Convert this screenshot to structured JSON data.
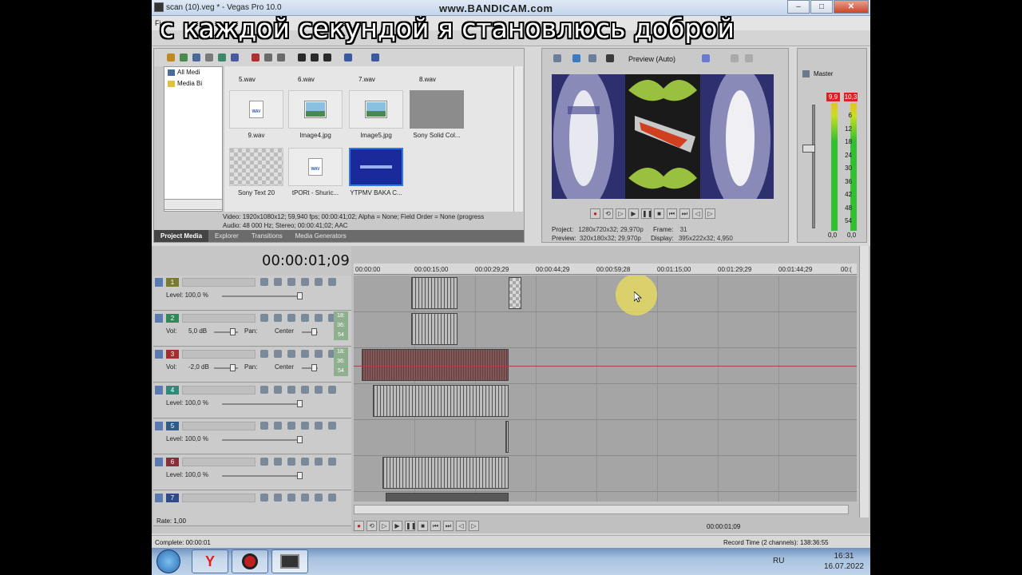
{
  "window": {
    "title": "scan (10).veg * - Vegas Pro 10.0",
    "minimize": "–",
    "maximize": "□",
    "close": "✕"
  },
  "watermark": "www.BANDICAM.com",
  "caption": "с каждой секундой я становлюсь доброй",
  "menu": {
    "first": "Fi"
  },
  "project_media": {
    "tree": [
      {
        "label": "All Medi",
        "icon": "monitor-icon"
      },
      {
        "label": "Media Bi",
        "icon": "folder-icon"
      }
    ],
    "top_row_labels": [
      "5.wav",
      "6.wav",
      "7.wav",
      "8.wav"
    ],
    "items": [
      {
        "label": "9.wav",
        "kind": "wav"
      },
      {
        "label": "Image4.jpg",
        "kind": "image"
      },
      {
        "label": "Image5.jpg",
        "kind": "image"
      },
      {
        "label": "Sony Solid Col...",
        "kind": "solid"
      },
      {
        "label": "Sony Text 20",
        "kind": "checker"
      },
      {
        "label": "tPORt - Shuric...",
        "kind": "wav"
      },
      {
        "label": "YTPMV BAKA C...",
        "kind": "video"
      }
    ],
    "wav_badge": "WAV",
    "info_video": "Video: 1920x1080x12; 59,940 fps; 00:00:41;02; Alpha = None; Field Order = None (progress",
    "info_audio": "Audio: 48 000 Hz; Stereo; 00:00:41;02; AAC",
    "tabs": [
      "Project Media",
      "Explorer",
      "Transitions",
      "Media Generators"
    ]
  },
  "preview": {
    "mode_label": "Preview (Auto)",
    "project_label": "Project:",
    "project_value": "1280x720x32; 29,970p",
    "preview_label": "Preview:",
    "preview_value": "320x180x32; 29,970p",
    "frame_label": "Frame:",
    "frame_value": "31",
    "display_label": "Display:",
    "display_value": "395x222x32; 4,950"
  },
  "master": {
    "label": "Master",
    "peak_left": "9,9",
    "peak_right": "10,3",
    "scale": [
      "6",
      "12",
      "18",
      "24",
      "30",
      "36",
      "42",
      "48",
      "54"
    ],
    "bottom_left": "0,0",
    "bottom_right": "0,0"
  },
  "timeline": {
    "timecode": "00:00:01;09",
    "ruler": [
      "00:00:00",
      "00:00:15;00",
      "00:00:29;29",
      "00:00:44;29",
      "00:00:59;28",
      "00:01:15;00",
      "00:01:29;29",
      "00:01:44;29",
      "00:("
    ],
    "tracks": [
      {
        "num": "1",
        "color": "#7a7a30",
        "type": "video",
        "level": "Level: 100,0 %"
      },
      {
        "num": "2",
        "color": "#2f8a5a",
        "type": "audio",
        "vol_label": "Vol:",
        "vol": "5,0 dB",
        "pan_label": "Pan:",
        "pan": "Center",
        "side": "18: 36: 54"
      },
      {
        "num": "3",
        "color": "#a03030",
        "type": "audio",
        "vol_label": "Vol:",
        "vol": "-2,0 dB",
        "pan_label": "Pan:",
        "pan": "Center",
        "side": "18: 36: 54"
      },
      {
        "num": "4",
        "color": "#2f8a7a",
        "type": "video",
        "level": "Level: 100,0 %"
      },
      {
        "num": "5",
        "color": "#2f5a8a",
        "type": "video",
        "level": "Level: 100,0 %"
      },
      {
        "num": "6",
        "color": "#8a2f3a",
        "type": "video",
        "level": "Level: 100,0 %"
      },
      {
        "num": "7",
        "color": "#2f4a8a",
        "type": "video",
        "level": ""
      }
    ],
    "rate": "Rate: 1,00",
    "cursor_time": "00:00:01;09"
  },
  "status": {
    "complete": "Complete: 00:00:01",
    "record_time": "Record Time (2 channels): 138:36:55"
  },
  "taskbar": {
    "lang": "RU",
    "time": "16:31",
    "date": "16.07.2022"
  }
}
